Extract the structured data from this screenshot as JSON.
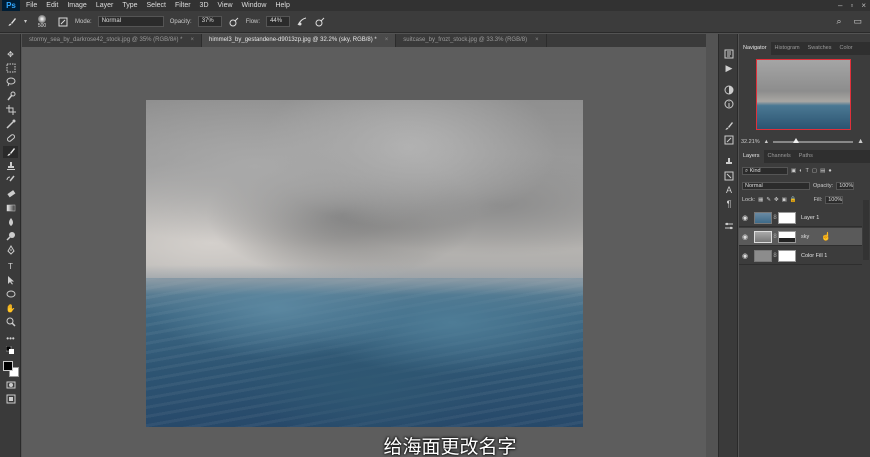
{
  "menubar": {
    "logo": "Ps",
    "items": [
      "File",
      "Edit",
      "Image",
      "Layer",
      "Type",
      "Select",
      "Filter",
      "3D",
      "View",
      "Window",
      "Help"
    ]
  },
  "options": {
    "brush_size": "500",
    "mode_label": "Mode:",
    "mode_value": "Normal",
    "opacity_label": "Opacity:",
    "opacity_value": "37%",
    "flow_label": "Flow:",
    "flow_value": "44%"
  },
  "tabs": [
    {
      "label": "stormy_sea_by_darkrose42_stock.jpg @ 35% (RGB/8#) *",
      "active": false
    },
    {
      "label": "himmel3_by_gestandene-d9013zp.jpg @ 32.2% (sky, RGB/8) *",
      "active": true
    },
    {
      "label": "suitcase_by_frozt_stock.jpg @ 33.3% (RGB/8)",
      "active": false
    }
  ],
  "subtitle": "给海面更改名字",
  "navigator": {
    "tabs": [
      "Navigator",
      "Histogram",
      "Swatches",
      "Color"
    ],
    "zoom": "32.21%"
  },
  "layers": {
    "tabs": [
      "Layers",
      "Channels",
      "Paths"
    ],
    "filter_label": "Kind",
    "blend_mode": "Normal",
    "opacity_label": "Opacity:",
    "opacity_value": "100%",
    "lock_label": "Lock:",
    "fill_label": "Fill:",
    "fill_value": "100%",
    "items": [
      {
        "name": "Layer 1"
      },
      {
        "name": "sky"
      },
      {
        "name": "Color Fill 1"
      }
    ]
  },
  "colors": {
    "accent": "#31a8ff",
    "nav_frame": "#e0303a",
    "foreground": "#000000",
    "background": "#ffffff"
  }
}
